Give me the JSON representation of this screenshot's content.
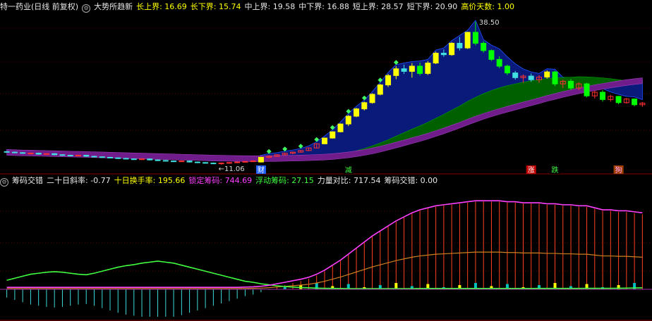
{
  "header": {
    "stock_title": "特一药业(日线 前复权)",
    "indicator_name": "大势所趋新",
    "items": [
      {
        "label": "长上界: 16.69",
        "color": "#ffff00"
      },
      {
        "label": "长下界: 15.74",
        "color": "#ffff00"
      },
      {
        "label": "中上界: 19.58",
        "color": "#e8e8e8"
      },
      {
        "label": "中下界: 16.88",
        "color": "#e8e8e8"
      },
      {
        "label": "短上界: 28.57",
        "color": "#e8e8e8"
      },
      {
        "label": "短下界: 20.90",
        "color": "#e8e8e8"
      },
      {
        "label": "高价天数: 1.00",
        "color": "#ffff00"
      }
    ]
  },
  "sub_header": {
    "indicator_name": "筹码交错",
    "items": [
      {
        "label": "二十日斜率: -0.77",
        "color": "#e8e8e8"
      },
      {
        "label": "十日换手率: 195.66",
        "color": "#ffff00"
      },
      {
        "label": "锁定筹码: 744.69",
        "color": "#ff40ff"
      },
      {
        "label": "浮动筹码: 27.15",
        "color": "#40ff40"
      },
      {
        "label": "力量对比: 717.54",
        "color": "#e8e8e8"
      },
      {
        "label": "筹码交错: 0.00",
        "color": "#e8e8e8"
      }
    ]
  },
  "annotations": {
    "high_label": "38.50",
    "low_label": "11.06"
  },
  "signals": [
    {
      "text": "财",
      "color": "#ffffff",
      "bg": "#2060ff",
      "at": 32
    },
    {
      "text": "减",
      "color": "#40ff40",
      "bg": "#000000",
      "at": 43
    },
    {
      "text": "涨",
      "color": "#ffffff",
      "bg": "#c00000",
      "at": 66
    },
    {
      "text": "跌",
      "color": "#40ff40",
      "bg": "#000000",
      "at": 69
    },
    {
      "text": "狗",
      "color": "#ffa0ff",
      "bg": "#a04000",
      "at": 77
    }
  ],
  "colors": {
    "bg": "#000000",
    "grid": "#5a0000",
    "up": "#ff3030",
    "down": "#40e0e0",
    "strong_up": "#ffff00",
    "strong_down": "#00ff00",
    "band_fill": "#0a1a7a",
    "band_edge": "#2050ff",
    "green_band": "#006000",
    "purple_band": "#701c8a",
    "locked": "#ff40ff",
    "floating": "#40ff40",
    "orange": "#d08020",
    "stick_neg": "#40d8d8",
    "stick_pos": "#ff4020"
  },
  "chart_data": [
    {
      "type": "candlestick",
      "title": "大势所趋新",
      "y_range": [
        10.0,
        40.0
      ],
      "max_label": 38.5,
      "min_label": 11.06,
      "candles_ohlc": [
        [
          13.6,
          13.7,
          13.4,
          13.5
        ],
        [
          13.5,
          13.6,
          13.3,
          13.4
        ],
        [
          13.4,
          13.5,
          13.2,
          13.3
        ],
        [
          13.3,
          13.4,
          13.1,
          13.3
        ],
        [
          13.3,
          13.4,
          13.0,
          13.1
        ],
        [
          13.1,
          13.3,
          13.0,
          13.2
        ],
        [
          13.2,
          13.3,
          12.9,
          13.0
        ],
        [
          13.0,
          13.1,
          12.8,
          12.9
        ],
        [
          12.9,
          13.0,
          12.7,
          12.8
        ],
        [
          12.8,
          13.0,
          12.7,
          12.9
        ],
        [
          12.9,
          13.0,
          12.6,
          12.7
        ],
        [
          12.7,
          12.8,
          12.5,
          12.6
        ],
        [
          12.6,
          12.7,
          12.4,
          12.5
        ],
        [
          12.5,
          12.6,
          12.3,
          12.4
        ],
        [
          12.4,
          12.5,
          12.2,
          12.3
        ],
        [
          12.3,
          12.4,
          12.1,
          12.2
        ],
        [
          12.2,
          12.3,
          12.0,
          12.1
        ],
        [
          12.1,
          12.3,
          12.0,
          12.2
        ],
        [
          12.2,
          12.3,
          11.9,
          12.0
        ],
        [
          12.0,
          12.1,
          11.8,
          11.9
        ],
        [
          11.9,
          12.0,
          11.7,
          11.8
        ],
        [
          11.8,
          11.9,
          11.6,
          11.7
        ],
        [
          11.7,
          11.9,
          11.6,
          11.8
        ],
        [
          11.8,
          11.9,
          11.5,
          11.6
        ],
        [
          11.6,
          11.7,
          11.4,
          11.5
        ],
        [
          11.5,
          11.6,
          11.3,
          11.4
        ],
        [
          11.4,
          11.5,
          11.2,
          11.3
        ],
        [
          11.3,
          11.5,
          11.1,
          11.4
        ],
        [
          11.4,
          11.6,
          11.3,
          11.5
        ],
        [
          11.5,
          11.7,
          11.4,
          11.6
        ],
        [
          11.6,
          11.8,
          11.5,
          11.7
        ],
        [
          11.7,
          11.9,
          11.6,
          11.8
        ],
        [
          11.6,
          12.6,
          11.5,
          12.5
        ],
        [
          12.5,
          12.9,
          12.3,
          12.7
        ],
        [
          12.7,
          13.1,
          12.6,
          13.0
        ],
        [
          13.0,
          13.4,
          12.9,
          13.3
        ],
        [
          13.3,
          13.6,
          13.1,
          13.5
        ],
        [
          13.5,
          13.9,
          13.4,
          13.8
        ],
        [
          13.8,
          14.4,
          13.7,
          14.3
        ],
        [
          14.3,
          15.2,
          14.2,
          15.1
        ],
        [
          15.1,
          16.3,
          15.0,
          16.2
        ],
        [
          16.2,
          17.5,
          16.1,
          17.4
        ],
        [
          17.4,
          19.0,
          17.3,
          18.9
        ],
        [
          18.9,
          20.6,
          18.5,
          20.4
        ],
        [
          20.4,
          22.0,
          20.2,
          21.8
        ],
        [
          21.8,
          23.2,
          21.5,
          23.0
        ],
        [
          23.0,
          24.8,
          22.8,
          24.6
        ],
        [
          24.6,
          26.6,
          24.4,
          26.4
        ],
        [
          26.4,
          28.5,
          26.0,
          28.2
        ],
        [
          28.2,
          30.0,
          27.5,
          29.5
        ],
        [
          29.5,
          30.3,
          28.5,
          29.0
        ],
        [
          29.0,
          30.6,
          27.8,
          30.0
        ],
        [
          30.0,
          30.7,
          28.2,
          28.6
        ],
        [
          28.6,
          31.0,
          28.3,
          30.6
        ],
        [
          30.6,
          32.8,
          30.4,
          32.5
        ],
        [
          32.5,
          33.2,
          31.8,
          32.2
        ],
        [
          32.2,
          34.6,
          32.0,
          34.4
        ],
        [
          34.4,
          35.6,
          33.0,
          33.5
        ],
        [
          33.5,
          36.6,
          33.3,
          36.5
        ],
        [
          36.5,
          38.5,
          34.0,
          34.4
        ],
        [
          34.4,
          34.8,
          32.6,
          33.0
        ],
        [
          33.0,
          33.2,
          31.0,
          31.3
        ],
        [
          31.3,
          31.9,
          29.6,
          30.0
        ],
        [
          30.0,
          30.3,
          28.3,
          28.7
        ],
        [
          28.7,
          29.1,
          27.4,
          27.8
        ],
        [
          27.8,
          28.4,
          26.8,
          28.1
        ],
        [
          28.1,
          28.6,
          27.0,
          27.4
        ],
        [
          27.4,
          28.3,
          26.8,
          27.9
        ],
        [
          27.9,
          29.2,
          27.6,
          28.9
        ],
        [
          28.9,
          29.1,
          26.2,
          26.6
        ],
        [
          26.6,
          27.4,
          25.8,
          27.1
        ],
        [
          27.1,
          27.5,
          25.4,
          25.8
        ],
        [
          25.8,
          26.9,
          25.4,
          26.6
        ],
        [
          26.6,
          26.8,
          24.0,
          24.3
        ],
        [
          24.3,
          25.3,
          23.8,
          25.0
        ],
        [
          25.0,
          25.4,
          23.2,
          23.6
        ],
        [
          23.6,
          24.5,
          23.2,
          24.2
        ],
        [
          24.2,
          24.3,
          22.7,
          23.0
        ],
        [
          23.0,
          23.9,
          22.8,
          23.7
        ],
        [
          23.7,
          23.8,
          22.3,
          22.6
        ],
        [
          22.6,
          23.1,
          22.2,
          22.9
        ]
      ]
    },
    {
      "type": "line",
      "title": "筹码交错",
      "y_range": [
        0,
        1000
      ],
      "series": [
        {
          "name": "锁定筹码",
          "values": [
            20,
            20,
            20,
            20,
            20,
            20,
            20,
            20,
            20,
            20,
            20,
            20,
            20,
            20,
            20,
            20,
            20,
            20,
            20,
            20,
            20,
            20,
            20,
            20,
            20,
            20,
            20,
            20,
            20,
            20,
            22,
            25,
            30,
            40,
            55,
            70,
            85,
            100,
            120,
            150,
            190,
            240,
            290,
            350,
            410,
            470,
            530,
            580,
            630,
            680,
            720,
            760,
            790,
            810,
            830,
            840,
            850,
            860,
            870,
            880,
            880,
            880,
            880,
            870,
            870,
            860,
            860,
            860,
            850,
            850,
            840,
            840,
            830,
            830,
            810,
            790,
            790,
            780,
            780,
            770,
            760
          ]
        },
        {
          "name": "浮动筹码",
          "values": [
            90,
            110,
            130,
            150,
            160,
            170,
            175,
            170,
            160,
            150,
            145,
            160,
            180,
            200,
            220,
            235,
            245,
            260,
            270,
            280,
            270,
            260,
            240,
            220,
            200,
            180,
            160,
            140,
            120,
            100,
            80,
            70,
            55,
            45,
            35,
            28,
            22,
            18,
            15,
            12,
            10,
            9,
            8,
            7,
            7,
            7,
            7,
            7,
            7,
            7,
            7,
            7,
            8,
            8,
            8,
            8,
            8,
            8,
            8,
            8,
            8,
            8,
            8,
            8,
            8,
            8,
            8,
            9,
            9,
            9,
            9,
            9,
            9,
            10,
            10,
            10,
            10,
            11,
            12,
            14,
            15
          ]
        },
        {
          "name": "力量对比",
          "values": [
            -70,
            -90,
            -110,
            -130,
            -140,
            -150,
            -155,
            -150,
            -140,
            -130,
            -125,
            -140,
            -160,
            -180,
            -200,
            -215,
            -225,
            -240,
            -250,
            -260,
            -250,
            -240,
            -220,
            -200,
            -180,
            -160,
            -140,
            -120,
            -100,
            -80,
            -58,
            -45,
            -25,
            -5,
            20,
            42,
            63,
            82,
            105,
            138,
            180,
            231,
            282,
            343,
            403,
            463,
            523,
            573,
            623,
            673,
            713,
            753,
            782,
            802,
            822,
            832,
            842,
            852,
            862,
            872,
            872,
            872,
            872,
            862,
            862,
            852,
            852,
            851,
            841,
            841,
            831,
            831,
            821,
            820,
            800,
            780,
            780,
            769,
            768,
            756,
            745
          ]
        }
      ]
    }
  ]
}
